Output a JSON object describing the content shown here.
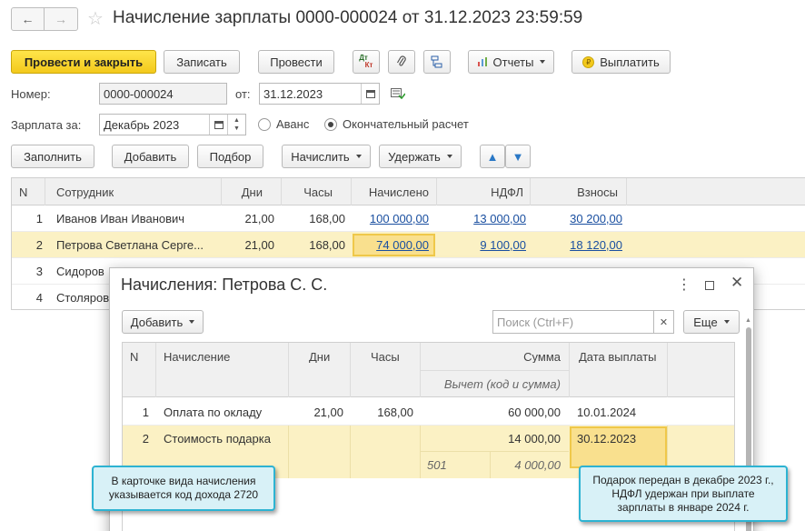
{
  "window": {
    "title": "Начисление зарплаты 0000-000024 от 31.12.2023 23:59:59"
  },
  "toolbar": {
    "post_close": "Провести и закрыть",
    "save": "Записать",
    "post": "Провести",
    "dt_icon_top": "Дт",
    "dt_icon_bottom": "Кт",
    "reports": "Отчеты",
    "pay": "Выплатить",
    "pay_icon": "₽"
  },
  "form": {
    "number_label": "Номер:",
    "number_value": "0000-000024",
    "date_label": "от:",
    "date_value": "31.12.2023",
    "salary_for_label": "Зарплата за:",
    "salary_for_value": "Декабрь 2023",
    "advance_label": "Аванс",
    "final_label": "Окончательный расчет"
  },
  "table_toolbar": {
    "fill": "Заполнить",
    "add": "Добавить",
    "pick": "Подбор",
    "accrue": "Начислить",
    "withhold": "Удержать"
  },
  "table": {
    "columns": [
      "N",
      "Сотрудник",
      "Дни",
      "Часы",
      "Начислено",
      "НДФЛ",
      "Взносы"
    ],
    "rows": [
      {
        "n": "1",
        "employee": "Иванов Иван Иванович",
        "days": "21,00",
        "hours": "168,00",
        "accrued": "100 000,00",
        "ndfl": "13 000,00",
        "contrib": "30 200,00"
      },
      {
        "n": "2",
        "employee": "Петрова Светлана Серге...",
        "days": "21,00",
        "hours": "168,00",
        "accrued": "74 000,00",
        "ndfl": "9 100,00",
        "contrib": "18 120,00"
      },
      {
        "n": "3",
        "employee": "Сидоров",
        "days": "",
        "hours": "",
        "accrued": "",
        "ndfl": "",
        "contrib": ""
      },
      {
        "n": "4",
        "employee": "Столяров",
        "days": "",
        "hours": "",
        "accrued": "",
        "ndfl": "",
        "contrib": ""
      }
    ]
  },
  "dialog": {
    "title": "Начисления: Петрова С. С.",
    "add": "Добавить",
    "search_placeholder": "Поиск (Ctrl+F)",
    "more": "Еще",
    "columns": {
      "n": "N",
      "accrual": "Начисление",
      "days": "Дни",
      "hours": "Часы",
      "sum": "Сумма",
      "pay_date": "Дата выплаты",
      "deduction": "Вычет (код и сумма)"
    },
    "rows": [
      {
        "n": "1",
        "accrual": "Оплата по окладу",
        "days": "21,00",
        "hours": "168,00",
        "sum": "60 000,00",
        "pay_date": "10.01.2024",
        "deduction_code": "",
        "deduction_sum": ""
      },
      {
        "n": "2",
        "accrual": "Стоимость подарка",
        "days": "",
        "hours": "",
        "sum": "14 000,00",
        "pay_date": "30.12.2023",
        "deduction_code": "501",
        "deduction_sum": "4 000,00"
      }
    ]
  },
  "callouts": {
    "left": "В карточке вида начисления указывается код дохода 2720",
    "right": "Подарок передан в декабре 2023 г., НДФЛ удержан при выплате зарплаты в январе 2024 г."
  }
}
